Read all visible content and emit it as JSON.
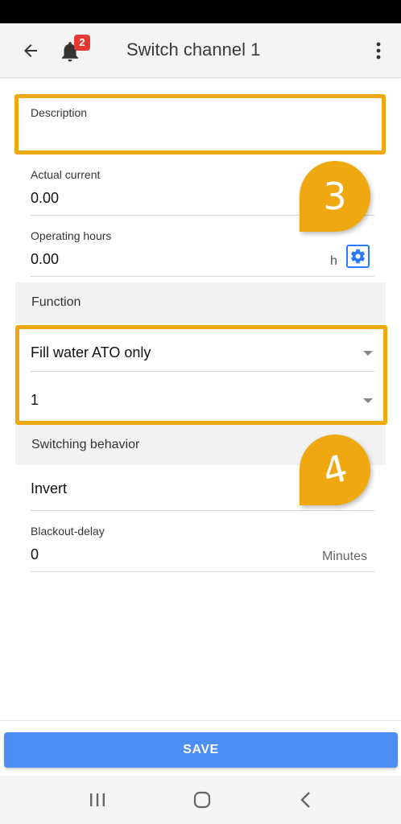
{
  "header": {
    "title": "Switch channel 1",
    "notification_count": "2"
  },
  "form": {
    "description": {
      "label": "Description",
      "value": ""
    },
    "actual_current": {
      "label": "Actual current",
      "value": "0.00"
    },
    "operating_hours": {
      "label": "Operating hours",
      "value": "0.00",
      "unit": "h"
    },
    "function_section": "Function",
    "function_select": {
      "value": "Fill water ATO only"
    },
    "channel_select": {
      "value": "1"
    },
    "switching_section": "Switching behavior",
    "invert": {
      "label": "Invert"
    },
    "blackout_delay": {
      "label": "Blackout-delay",
      "value": "0",
      "unit": "Minutes"
    }
  },
  "annotations": {
    "callout_a": "3",
    "callout_b": "4"
  },
  "footer": {
    "save_label": "SAVE"
  },
  "colors": {
    "accent": "#4d8ef5",
    "highlight": "#f0a811",
    "badge": "#e53935"
  },
  "icons": [
    "back-arrow-icon",
    "bell-icon",
    "more-vert-icon",
    "gear-icon",
    "dropdown-caret-icon",
    "recents-icon",
    "home-icon",
    "back-nav-icon"
  ]
}
